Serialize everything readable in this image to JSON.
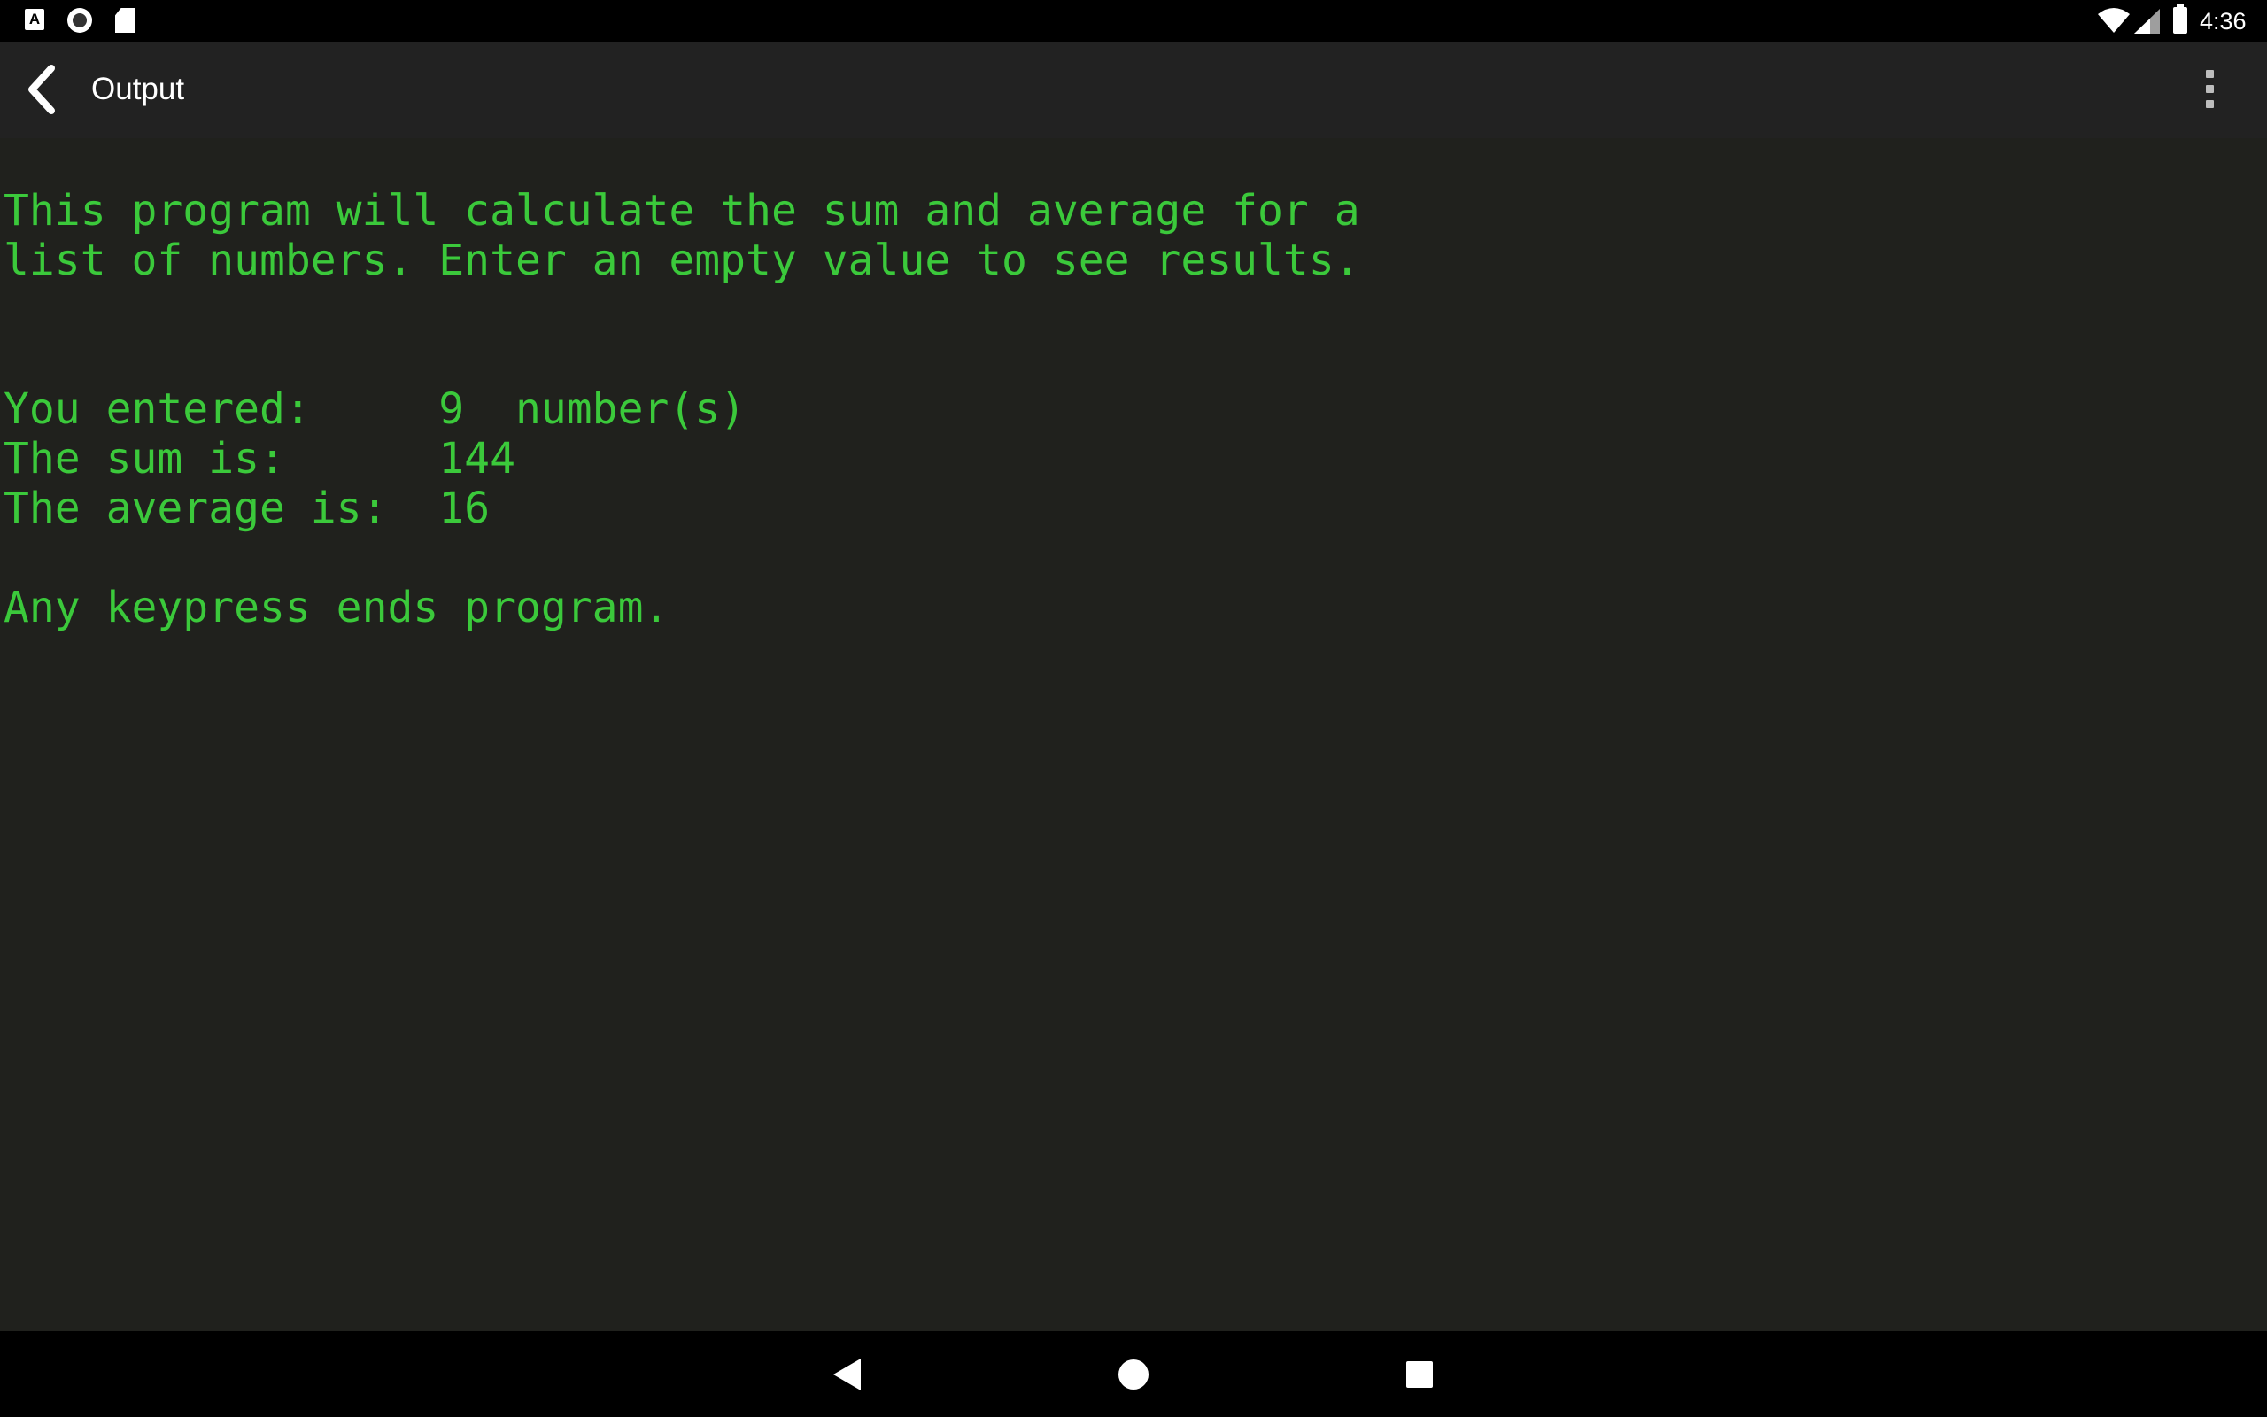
{
  "status_bar": {
    "time": "4:36",
    "left_icons": [
      "a-notification-icon",
      "circle-notification-icon",
      "sd-card-icon"
    ],
    "right_icons": [
      "wifi-icon",
      "signal-icon",
      "battery-charging-icon"
    ],
    "a_icon_text": "A"
  },
  "app_bar": {
    "title": "Output",
    "back_icon": "chevron-left-icon",
    "menu_icon": "more-vert-icon"
  },
  "console": {
    "lines": [
      "This program will calculate the sum and average for a",
      "list of numbers. Enter an empty value to see results.",
      "",
      "",
      "You entered:     9  number(s)",
      "The sum is:      144",
      "The average is:  16",
      "",
      "Any keypress ends program."
    ]
  },
  "nav_bar": {
    "icons": [
      "nav-back-icon",
      "nav-home-icon",
      "nav-recents-icon"
    ]
  },
  "colors": {
    "console_text": "#3bc93b",
    "console_bg": "#20211d",
    "app_bar_bg": "#222222"
  }
}
